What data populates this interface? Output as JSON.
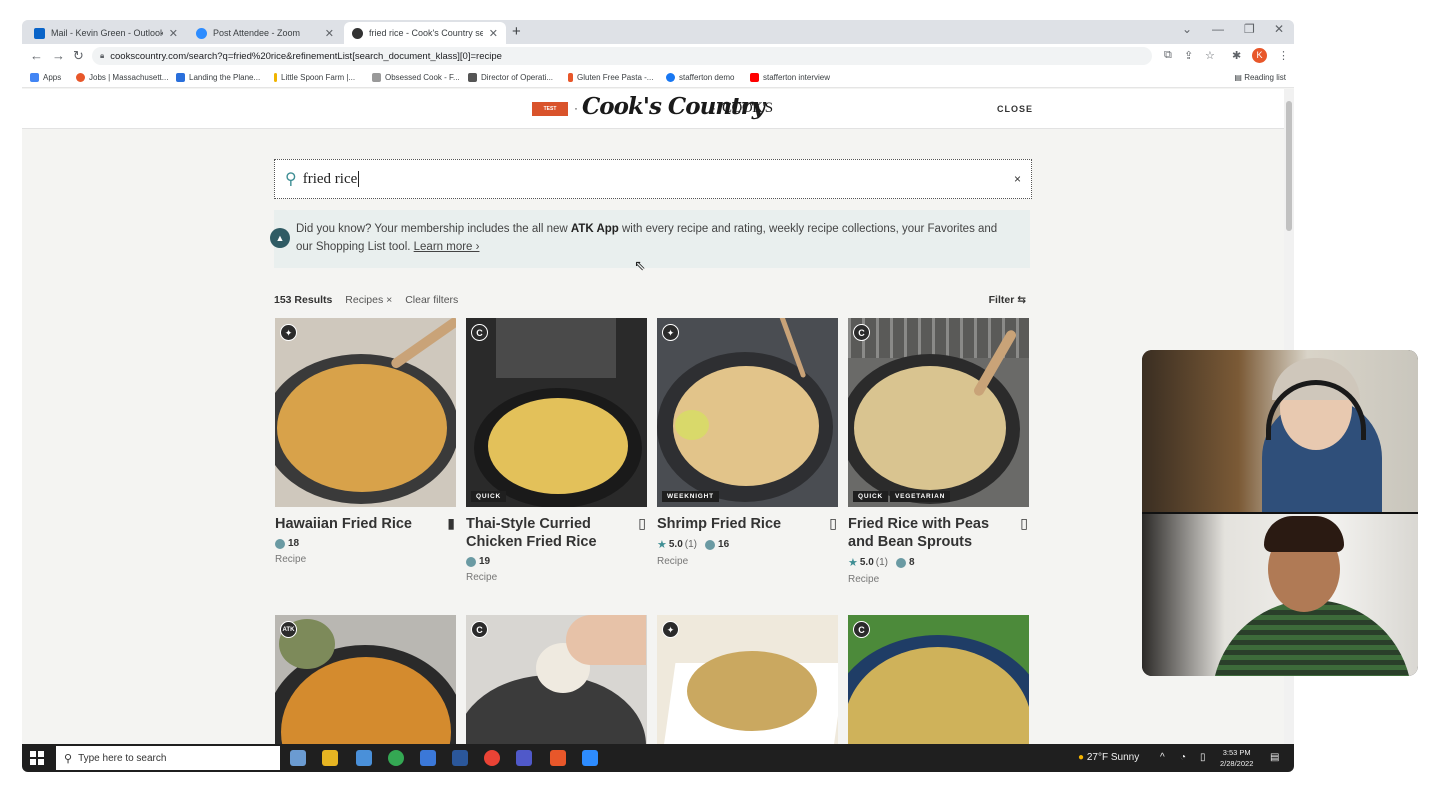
{
  "browser": {
    "tabs": [
      {
        "title": "Mail - Kevin Green - Outlook",
        "icon": "outlook-icon",
        "color": "#0a64c8"
      },
      {
        "title": "Post Attendee - Zoom",
        "icon": "zoom-icon",
        "color": "#2d8cff"
      },
      {
        "title": "fried rice - Cook's Country search",
        "icon": "cooks-country-icon",
        "color": "#333333"
      }
    ],
    "new_tab": "+",
    "url": "cookscountry.com/search?q=fried%20rice&refinementList[search_document_klass][0]=recipe",
    "profile_initial": "K",
    "bookmarks": [
      {
        "label": "Apps",
        "color": "#4285f4"
      },
      {
        "label": "Jobs | Massachusett...",
        "color": "#e8572a"
      },
      {
        "label": "Landing the Plane...",
        "color": "#2a6fdb"
      },
      {
        "label": "Little Spoon Farm |...",
        "color": "#f0b400"
      },
      {
        "label": "Obsessed Cook - F...",
        "color": "#999999"
      },
      {
        "label": "Director of Operati...",
        "color": "#555555"
      },
      {
        "label": "Gluten Free Pasta -...",
        "color": "#e8572a"
      },
      {
        "label": "stafferton demo",
        "color": "#1877f2"
      },
      {
        "label": "stafferton interview",
        "color": "#ff0000"
      }
    ],
    "reading_list": "Reading list"
  },
  "site": {
    "atk_badge": "TEST KITCHEN",
    "logo_main": "Cook's Country",
    "logo_secondary": "COOK'S",
    "close_label": "CLOSE"
  },
  "search": {
    "value": "fried rice",
    "clear": "×"
  },
  "info": {
    "text_before": "Did you know? Your membership includes the all new ",
    "bold": "ATK App",
    "text_after": " with every recipe and rating, weekly recipe collections, your Favorites and our Shopping List tool. ",
    "link": "Learn more ›"
  },
  "results": {
    "count": "153 Results",
    "chip": "Recipes ×",
    "clear_filters": "Clear filters",
    "filter_label": "Filter ⇆"
  },
  "recipes": [
    {
      "title": "Hawaiian Fried Rice",
      "badge": "",
      "tags": [],
      "rating": "",
      "rating_count": "",
      "comments": "18",
      "type": "Recipe",
      "bookmarked": true,
      "bg": "#cfc8bd",
      "pan": "#3a3a3a",
      "food": "#d8a24a"
    },
    {
      "title": "Thai-Style Curried Chicken Fried Rice",
      "badge": "C",
      "tags": [
        "QUICK"
      ],
      "rating": "",
      "rating_count": "",
      "comments": "19",
      "type": "Recipe",
      "bookmarked": false,
      "bg": "#2a2a2a",
      "pan": "#1a1a1a",
      "food": "#e3c15a"
    },
    {
      "title": "Shrimp Fried Rice",
      "badge": "",
      "tags": [
        "WEEKNIGHT"
      ],
      "rating": "5.0",
      "rating_count": "(1)",
      "comments": "16",
      "type": "Recipe",
      "bookmarked": false,
      "bg": "#4a4d52",
      "pan": "#2e2f32",
      "food": "#e2c48a"
    },
    {
      "title": "Fried Rice with Peas and Bean Sprouts",
      "badge": "C",
      "tags": [
        "QUICK",
        "VEGETARIAN"
      ],
      "rating": "5.0",
      "rating_count": "(1)",
      "comments": "8",
      "type": "Recipe",
      "bookmarked": false,
      "bg": "#6a6a68",
      "pan": "#2b2b2b",
      "food": "#d9c490"
    },
    {
      "title": "",
      "badge": "ATK",
      "tags": [],
      "bg": "#b9b7b2",
      "pan": "#2a2a2a",
      "food": "#d48b2e"
    },
    {
      "title": "",
      "badge": "C",
      "tags": [],
      "bg": "#d8d6d2",
      "pan": "#3b3b3b",
      "food": "#efeae0"
    },
    {
      "title": "",
      "badge": "",
      "tags": [],
      "bg": "#efe9dc",
      "pan": "#ffffff",
      "food": "#caa860"
    },
    {
      "title": "",
      "badge": "C",
      "tags": [],
      "bg": "#4c8a3a",
      "pan": "#1f3d66",
      "food": "#cfb25a"
    }
  ],
  "taskbar": {
    "search_placeholder": "Type here to search",
    "weather": "27°F  Sunny",
    "time": "3:53 PM",
    "date": "2/28/2022"
  }
}
